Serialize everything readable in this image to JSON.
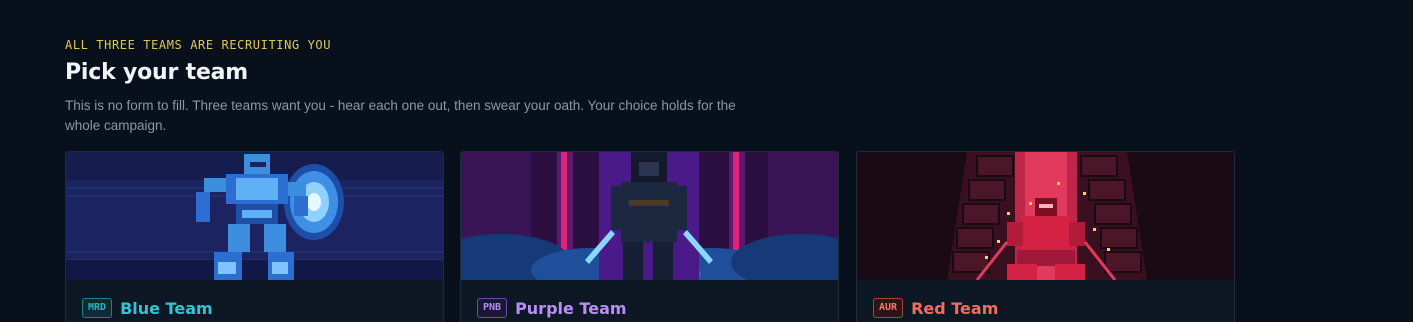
{
  "header": {
    "eyebrow": "ALL THREE TEAMS ARE RECRUITING YOU",
    "title": "Pick your team",
    "description": "This is no form to fill. Three teams want you - hear each one out, then swear your oath. Your choice holds for the whole campaign."
  },
  "teams": [
    {
      "code": "MRD",
      "name": "Blue Team",
      "accent": "#33c3d4",
      "art": "armored-robot-with-shield"
    },
    {
      "code": "PNB",
      "name": "Purple Team",
      "accent": "#b98ff7",
      "art": "hooded-figure-with-dual-blades"
    },
    {
      "code": "AUR",
      "name": "Red Team",
      "accent": "#f36d5f",
      "art": "red-warrior-in-throne-gate"
    }
  ]
}
